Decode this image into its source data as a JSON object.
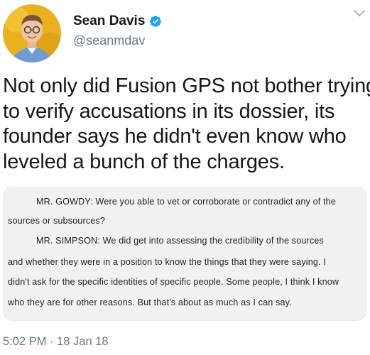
{
  "tweet": {
    "author": {
      "display_name": "Sean Davis",
      "handle": "@seanmdav",
      "verified": true,
      "avatar": "profile-photo"
    },
    "text_lines": [
      "Not only did Fusion GPS not bother trying",
      "to verify accusations in its dossier, its",
      "founder says he didn't even know who",
      "leveled a bunch of the charges."
    ],
    "media": {
      "transcript_lines": [
        "MR. GOWDY:  Were you able to vet or corroborate or contradict any of the",
        "sources or subsources?",
        "MR. SIMPSON:  We did get into assessing the credibility of the sources",
        "and whether they were in a position to know the things that they were saying.   I",
        "didn't ask for the specific identities of specific people.  Some people, I think I know",
        "who they are for other reasons.   But that's about as much as I can say."
      ]
    },
    "timestamp": "5:02 PM · 18 Jan 18"
  },
  "icons": {
    "verified": "verified-badge-icon",
    "menu": "chevron-down-icon"
  },
  "colors": {
    "verified_blue": "#1da1f2",
    "secondary_text": "#657786",
    "primary_text": "#14171a"
  }
}
